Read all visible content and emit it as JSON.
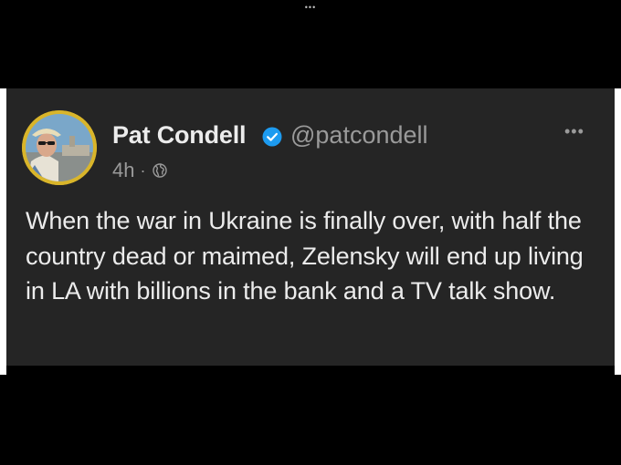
{
  "top_bar": {
    "handle_dots": "•••"
  },
  "tweet": {
    "author_name": "Pat Condell",
    "author_handle": "@patcondell",
    "verified": true,
    "timestamp": "4h",
    "separator": "·",
    "visibility_icon": "globe-icon",
    "more_label": "•••",
    "text": "When the war in Ukraine is finally over, with half the country dead or maimed, Zelensky will end up living in LA with billions in the bank and a TV talk show."
  },
  "colors": {
    "page_background": "#000000",
    "card_background": "#252525",
    "primary_text": "#ececec",
    "secondary_text": "#9a9a9a",
    "verified_badge": "#1d9bf0",
    "avatar_ring": "#d9b52a"
  }
}
